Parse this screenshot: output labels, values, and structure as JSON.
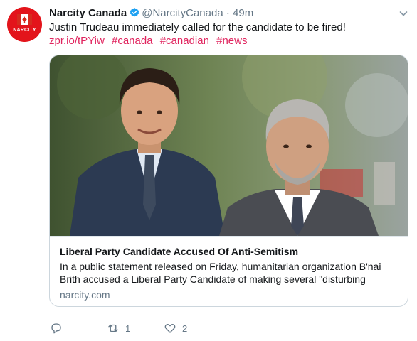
{
  "tweet": {
    "author_name": "Narcity Canada",
    "author_handle": "@NarcityCanada",
    "separator": "·",
    "timestamp": "49m",
    "avatar_wordmark": "NARCITY",
    "text": "Justin Trudeau immediately called for the candidate to be fired!",
    "link": "zpr.io/tPYiw",
    "hashtags": [
      "#canada",
      "#canadian",
      "#news"
    ]
  },
  "card": {
    "title": "Liberal Party Candidate Accused Of Anti-Semitism",
    "description": "In a public statement released on Friday, humanitarian organization B'nai Brith accused a Liberal Party Candidate of making several \"disturbing",
    "domain": "narcity.com"
  },
  "actions": {
    "reply_count": "",
    "retweet_count": "1",
    "like_count": "2"
  },
  "colors": {
    "link": "#e0245e",
    "brand_red": "#e3141b",
    "verified": "#1da1f2",
    "muted": "#657786",
    "border": "#ccd6dd"
  },
  "icons": [
    "canada-flag-icon",
    "verified-badge-icon",
    "chevron-down-icon",
    "reply-icon",
    "retweet-icon",
    "heart-icon"
  ]
}
